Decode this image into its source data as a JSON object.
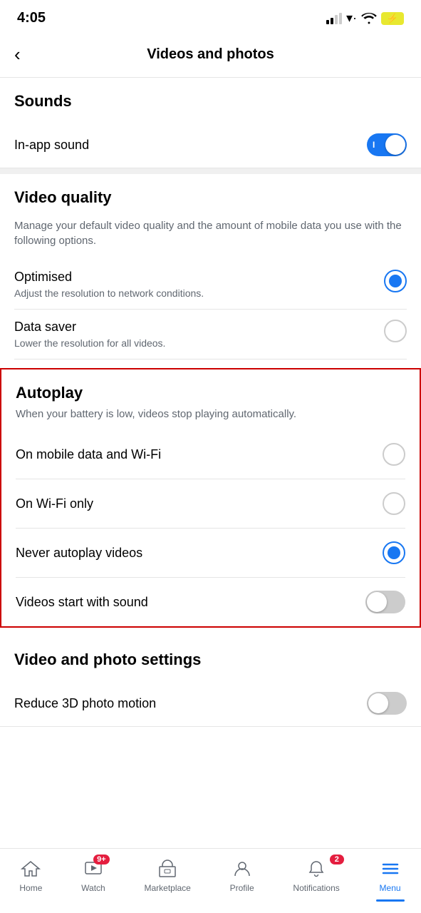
{
  "statusBar": {
    "time": "4:05",
    "battery": "⚡"
  },
  "header": {
    "back": "<",
    "title": "Videos and photos"
  },
  "sounds": {
    "sectionTitle": "Sounds",
    "inAppSound": {
      "label": "In-app sound",
      "enabled": true
    }
  },
  "videoQuality": {
    "sectionTitle": "Video quality",
    "description": "Manage your default video quality and the amount of mobile data you use with the following options.",
    "options": [
      {
        "title": "Optimised",
        "desc": "Adjust the resolution to network conditions.",
        "selected": true
      },
      {
        "title": "Data saver",
        "desc": "Lower the resolution for all videos.",
        "selected": false
      }
    ]
  },
  "autoplay": {
    "sectionTitle": "Autoplay",
    "description": "When your battery is low, videos stop playing automatically.",
    "options": [
      {
        "label": "On mobile data and Wi-Fi",
        "selected": false
      },
      {
        "label": "On Wi-Fi only",
        "selected": false
      },
      {
        "label": "Never autoplay videos",
        "selected": true
      }
    ],
    "soundToggle": {
      "label": "Videos start with sound",
      "enabled": false
    }
  },
  "videoPhotoSettings": {
    "sectionTitle": "Video and photo settings",
    "options": [
      {
        "label": "Reduce 3D photo motion",
        "enabled": false
      }
    ]
  },
  "bottomNav": {
    "items": [
      {
        "id": "home",
        "label": "Home",
        "badge": null,
        "active": false
      },
      {
        "id": "watch",
        "label": "Watch",
        "badge": "9+",
        "active": false
      },
      {
        "id": "marketplace",
        "label": "Marketplace",
        "badge": null,
        "active": false
      },
      {
        "id": "profile",
        "label": "Profile",
        "badge": null,
        "active": false
      },
      {
        "id": "notifications",
        "label": "Notifications",
        "badge": "2",
        "active": false
      },
      {
        "id": "menu",
        "label": "Menu",
        "badge": null,
        "active": true
      }
    ]
  }
}
